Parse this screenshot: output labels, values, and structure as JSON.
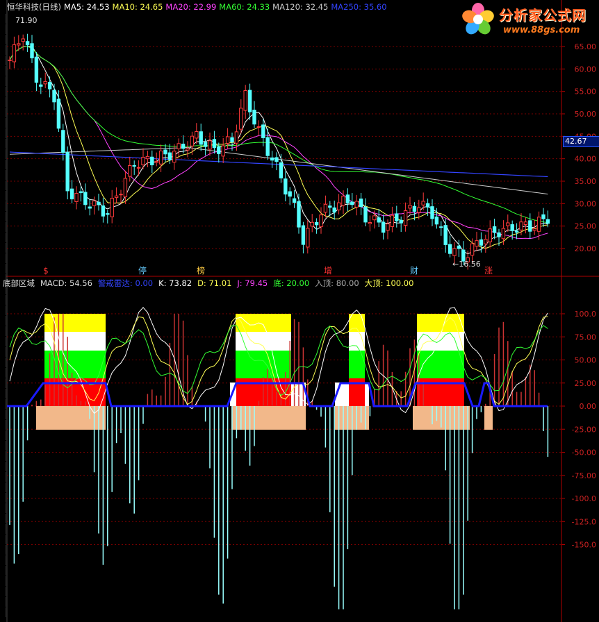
{
  "header": {
    "stock_title": "恒华科技(日线)",
    "ma": [
      {
        "label": "MA5: 24.53",
        "color": "#ffffff"
      },
      {
        "label": "MA10: 24.65",
        "color": "#ffff55"
      },
      {
        "label": "MA20: 22.99",
        "color": "#ff44ff"
      },
      {
        "label": "MA60: 24.33",
        "color": "#33ff33"
      },
      {
        "label": "MA120: 32.45",
        "color": "#cccccc"
      },
      {
        "label": "MA250: 35.60",
        "color": "#3344ff"
      }
    ]
  },
  "logo": {
    "name": "分析家公式网",
    "url": "www.88gs.com"
  },
  "price_panel": {
    "y_ticks": [
      "65.00",
      "60.00",
      "55.00",
      "50.00",
      "45.00",
      "40.00",
      "35.00",
      "30.00",
      "25.00",
      "20.00"
    ],
    "current_price": "42.67",
    "high_marker": "71.90",
    "low_marker": "16.56",
    "event_markers": [
      {
        "text": "$",
        "color": "#ff3333"
      },
      {
        "text": "停",
        "color": "#66ccff"
      },
      {
        "text": "榜",
        "color": "#ffcc44"
      },
      {
        "text": "增",
        "color": "#ff3333"
      },
      {
        "text": "财",
        "color": "#66ccff"
      },
      {
        "text": "涨",
        "color": "#ff3333"
      }
    ]
  },
  "indicator_panel": {
    "header": [
      {
        "label": "底部区域",
        "color": "#dddddd"
      },
      {
        "label": "MACD: 54.56",
        "color": "#dddddd"
      },
      {
        "label": "警戒雷达: 0.00",
        "color": "#3344ff"
      },
      {
        "label": "K: 73.82",
        "color": "#ffffff"
      },
      {
        "label": "D: 71.01",
        "color": "#ffff55"
      },
      {
        "label": "J: 79.45",
        "color": "#ff44ff"
      },
      {
        "label": "底: 20.00",
        "color": "#33ff33"
      },
      {
        "label": "入顶: 80.00",
        "color": "#aaaaaa"
      },
      {
        "label": "大顶: 100.00",
        "color": "#ffff55"
      }
    ],
    "y_ticks": [
      "100.0",
      "75.00",
      "50.00",
      "25.00",
      "0.00",
      "-25.00",
      "-50.00",
      "-75.00",
      "-100.0",
      "-125.0",
      "-150.0"
    ]
  },
  "colors": {
    "axis": "#b00000",
    "grid": "#7a0000",
    "up_candle": "#ff3b3b",
    "down_candle": "#55ffff",
    "macd_pos": "#cc3333",
    "macd_neg": "#99ffff",
    "radar": "#1a1aff",
    "zone_yellow": "#ffff00",
    "zone_white": "#ffffff",
    "zone_green": "#00ff00",
    "zone_red": "#ff0000",
    "zone_peach": "#f2b88a"
  }
}
